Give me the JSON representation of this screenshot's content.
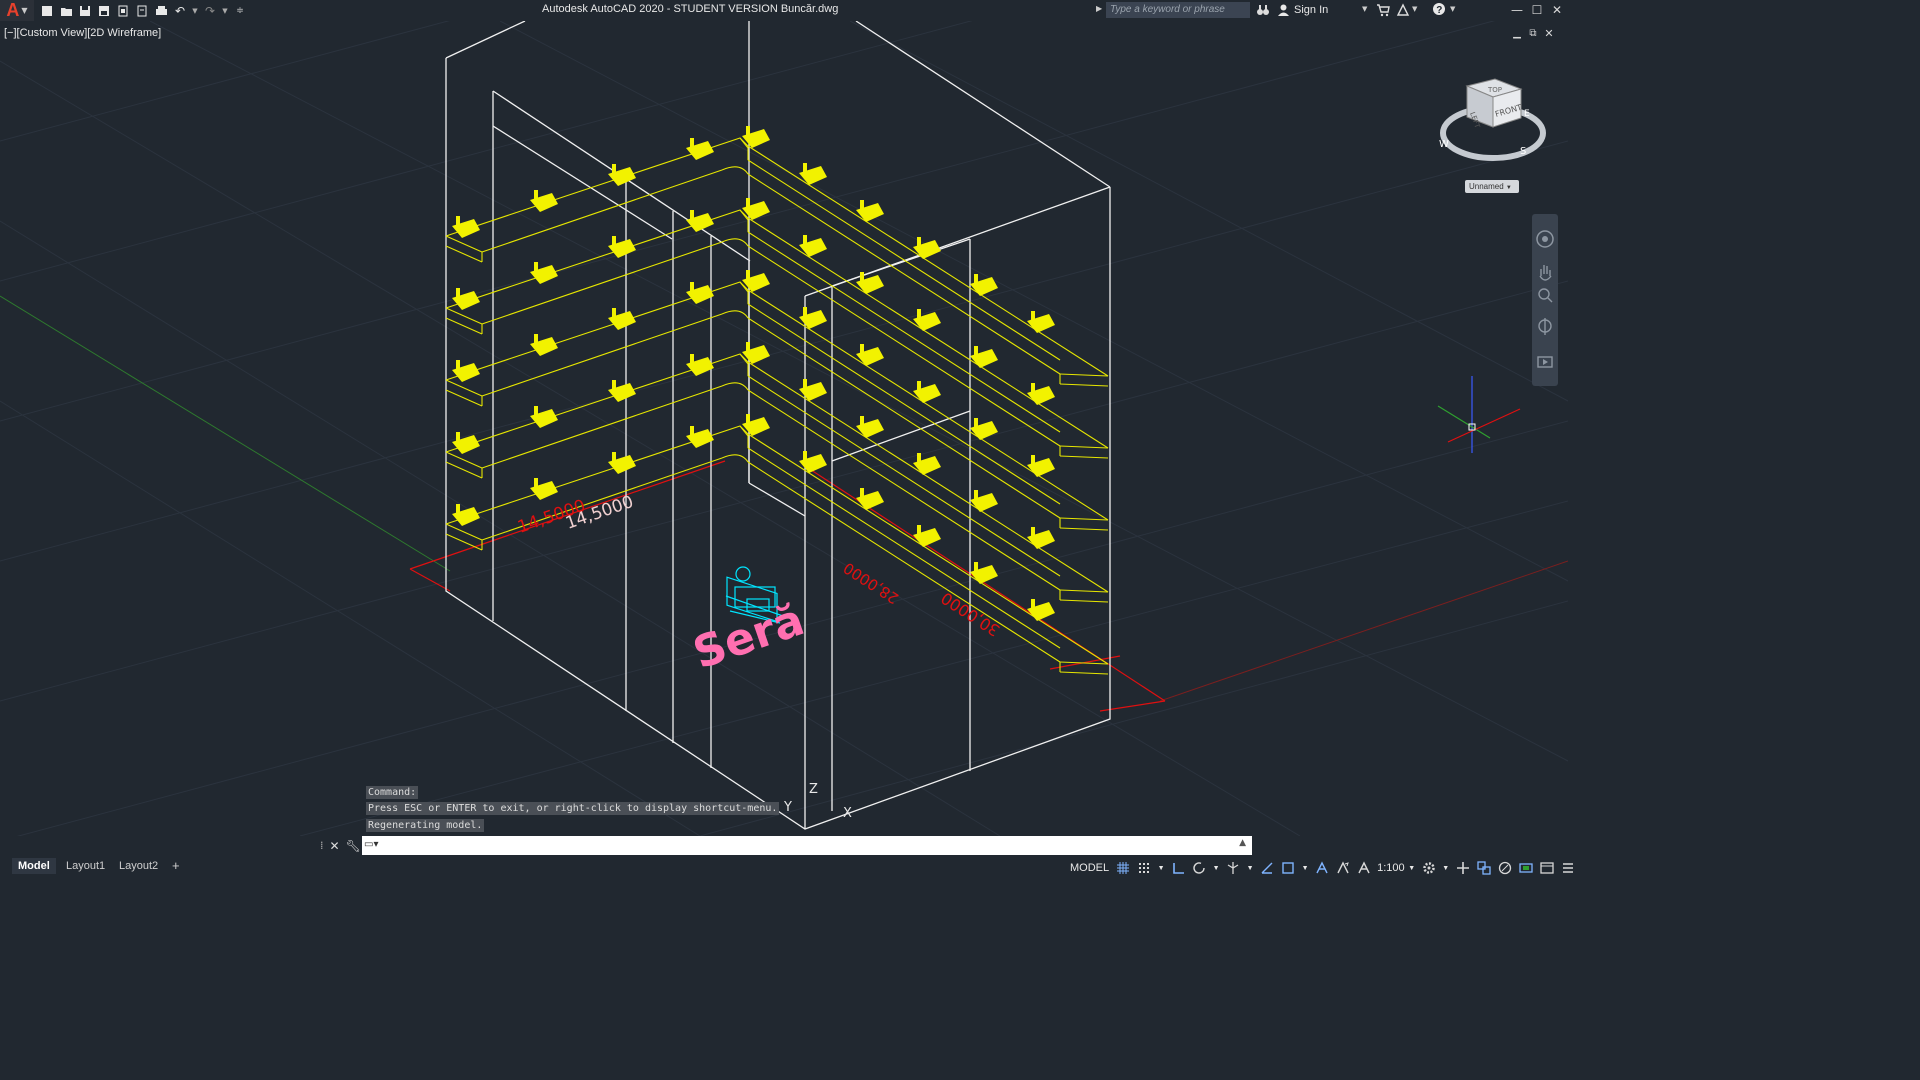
{
  "window": {
    "title": "Autodesk AutoCAD 2020 - STUDENT VERSION    Buncăr.dwg",
    "search_placeholder": "Type a keyword or phrase",
    "sign_in": "Sign In"
  },
  "viewport": {
    "label": "[−][Custom View][2D Wireframe]",
    "view_cube": {
      "top": "TOP",
      "front": "FRONT",
      "left": "LEFT",
      "compass": [
        "W",
        "S",
        "E"
      ]
    },
    "ucs_name": "Unnamed"
  },
  "drawing": {
    "dimensions": [
      "14,5000",
      "14,5000",
      "28,0000",
      "30,0000"
    ],
    "text_label": "Seră",
    "axis_labels": {
      "y": "Y",
      "z": "Z",
      "x": "X"
    },
    "colors": {
      "frame": "#ffffff",
      "shelves": "#e6e600",
      "dimension": "#ff2020",
      "label": "#ff6fb0",
      "equipment": "#00e5ff"
    }
  },
  "command": {
    "history": [
      "Command:",
      "Press ESC or ENTER to exit, or right-click to display shortcut-menu.",
      "Regenerating model."
    ],
    "input_value": ""
  },
  "tabs": [
    "Model",
    "Layout1",
    "Layout2"
  ],
  "status": {
    "mode": "MODEL",
    "scale": "1:100"
  }
}
